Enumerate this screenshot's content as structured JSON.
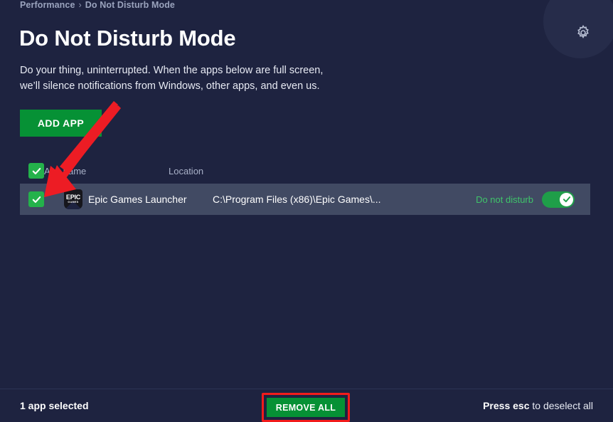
{
  "breadcrumb": {
    "parent": "Performance",
    "separator": "›",
    "current": "Do Not Disturb Mode"
  },
  "header": {
    "title": "Do Not Disturb Mode",
    "description": "Do your thing, uninterrupted. When the apps below are full screen,\nwe’ll silence notifications from Windows, other apps, and even us.",
    "settings_icon": "gear-icon"
  },
  "toolbar": {
    "add_app_label": "ADD APP"
  },
  "table": {
    "columns": {
      "app_name": "App name",
      "location": "Location"
    },
    "header_checkbox_checked": true,
    "rows": [
      {
        "checked": true,
        "icon": "epic-games-icon",
        "icon_text_top": "EPIC",
        "icon_text_bottom": "GAMES",
        "app_name": "Epic Games Launcher",
        "location": "C:\\Program Files (x86)\\Epic Games\\...",
        "dnd_label": "Do not disturb",
        "dnd_enabled": true
      }
    ]
  },
  "footer": {
    "selection_count": "1 app selected",
    "remove_all_label": "REMOVE ALL",
    "hint_bold": "Press esc",
    "hint_rest": " to deselect all"
  },
  "annotations": {
    "arrow_color": "#ed1c24",
    "highlight_border_color": "#f21b1b"
  },
  "colors": {
    "background": "#1e2340",
    "row_background": "#414a63",
    "accent_green": "#069135",
    "checkbox_green": "#24b24b",
    "toggle_green": "#1f9e49",
    "dnd_text_green": "#3fc46a",
    "muted_text": "#9aa3bd"
  }
}
